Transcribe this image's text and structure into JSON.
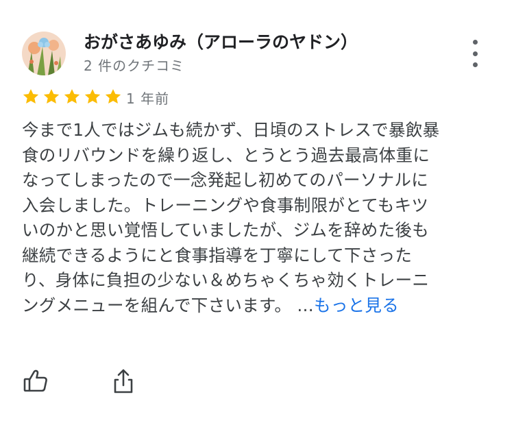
{
  "reviewer": {
    "name": "おがさあゆみ（アローラのヤドン）",
    "review_count": "2 件のクチコミ"
  },
  "rating": {
    "stars": 5,
    "max": 5,
    "color": "#fbbc04"
  },
  "review": {
    "date": "1 年前",
    "lines": [
      "今まで1人ではジムも続かず、日頃のストレスで暴飲暴",
      "食のリバウンドを繰り返し、とうとう過去最高体重に",
      "なってしまったので一念発起し初めてのパーソナルに",
      "入会しました。トレーニングや食事制限がとてもキツ",
      "いのかと思い覚悟していましたが、ジムを辞めた後も",
      "継続できるようにと食事指導を丁寧にして下さった",
      "り、身体に負担の少ない＆めちゃくちゃ効くトレーニ",
      "ングメニューを組んで下さいます。"
    ],
    "ellipsis": "…",
    "more_label": "もっと見る"
  },
  "icons": {
    "menu": "more-vert-icon",
    "like": "thumb-up-icon",
    "share": "share-icon",
    "star": "star-icon"
  },
  "colors": {
    "link": "#1a73e8",
    "secondary_text": "#70757a"
  }
}
